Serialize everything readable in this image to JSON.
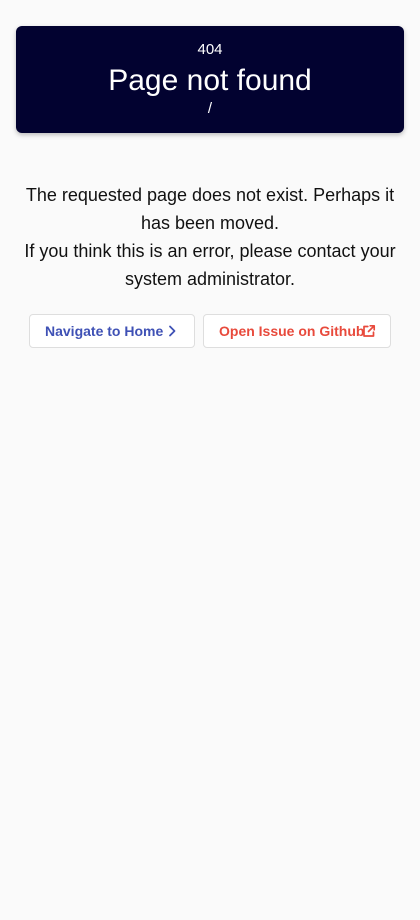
{
  "error": {
    "status_code": "404",
    "title": "Page not found",
    "path": "/"
  },
  "message": {
    "line1": "The requested page does not exist. Perhaps it has been moved.",
    "line2": "If you think this is an error, please contact your system administrator."
  },
  "actions": {
    "home": {
      "label": "Navigate to Home",
      "icon": "chevron-right-icon",
      "color": "#3f51b5"
    },
    "github": {
      "label": "Open Issue on Github",
      "icon": "external-link-icon",
      "color": "#e84a3c"
    }
  },
  "colors": {
    "header_background": "#020230",
    "page_background": "#fafafa"
  }
}
